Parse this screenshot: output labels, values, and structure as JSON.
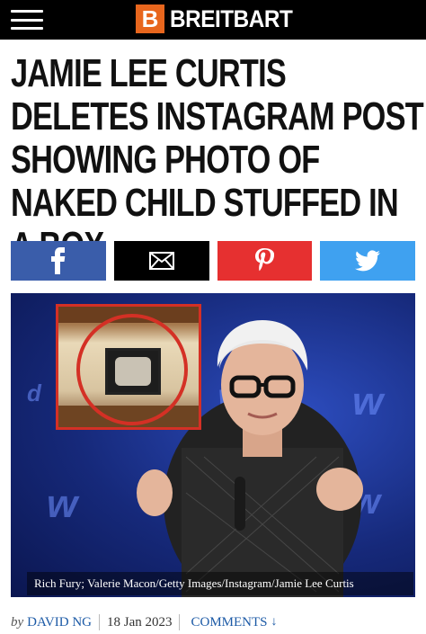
{
  "header": {
    "brand_letter": "B",
    "brand_name": "BREITBART",
    "brand_color": "#e8661d"
  },
  "article": {
    "headline": "JAMIE LEE CURTIS DELETES INSTAGRAM POST SHOWING PHOTO OF NAKED CHILD STUFFED IN A BOX",
    "photo_caption": "Rich Fury; Valerie Macon/Getty Images/Instagram/Jamie Lee Curtis",
    "byline_prefix": "by",
    "author": "DAVID NG",
    "date": "18 Jan 2023",
    "comments_label": "COMMENTS",
    "comments_arrow": "↓"
  },
  "share": {
    "facebook_icon": "facebook-icon",
    "email_icon": "email-icon",
    "pinterest_icon": "pinterest-icon",
    "twitter_icon": "twitter-icon",
    "colors": {
      "facebook": "#3a5daa",
      "email": "#000000",
      "pinterest": "#e63030",
      "twitter": "#3fa1f0"
    }
  }
}
